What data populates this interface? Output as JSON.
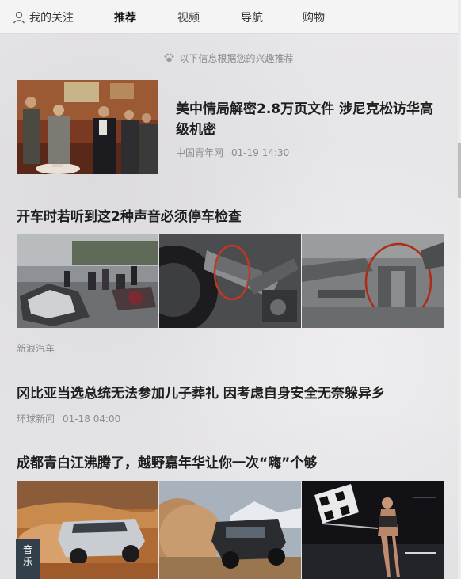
{
  "nav": {
    "follow_label": "我的关注",
    "tabs": [
      {
        "label": "推荐",
        "active": true
      },
      {
        "label": "视频"
      },
      {
        "label": "导航"
      },
      {
        "label": "购物"
      }
    ]
  },
  "hint_text": "以下信息根据您的兴趣推荐",
  "articles": [
    {
      "title": "美中情局解密2.8万页文件 涉尼克松访华高级机密",
      "source": "中国青年网",
      "time": "01-19 14:30"
    },
    {
      "title": "开车时若听到这2种声音必须停车检查",
      "source": "新浪汽车"
    },
    {
      "title": "冈比亚当选总统无法参加儿子葬礼 因考虑自身安全无奈躲异乡",
      "source": "环球新闻",
      "time": "01-18 04:00"
    },
    {
      "title": "成都青白江沸腾了，越野嘉年华让你一次“嗨”个够"
    }
  ],
  "music_badge": {
    "line1": "音",
    "line2": "乐"
  },
  "colors": {
    "background": "#e4e3e6",
    "topbar": "#f4f4f4",
    "badge": "#31404a",
    "meta": "#8c8c8c"
  }
}
